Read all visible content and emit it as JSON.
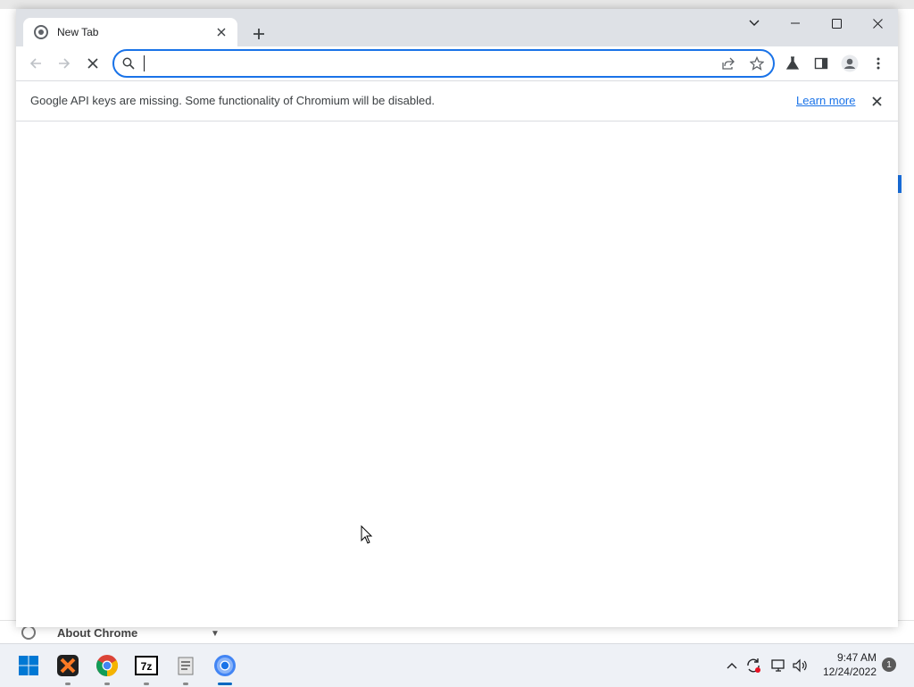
{
  "background": {
    "about_chrome_label": "About Chrome"
  },
  "browser": {
    "tab": {
      "title": "New Tab"
    },
    "omnibox": {
      "value": "",
      "placeholder": ""
    },
    "infobar": {
      "message": "Google API keys are missing. Some functionality of Chromium will be disabled.",
      "link_label": "Learn more"
    }
  },
  "taskbar": {
    "apps": [
      "start-icon",
      "xampp-icon",
      "chrome-icon",
      "7zip-icon",
      "files-icon",
      "chromium-icon"
    ],
    "sevenzip_label": "7z",
    "clock": {
      "time": "9:47 AM",
      "date": "12/24/2022"
    },
    "notification_count": "1"
  },
  "colors": {
    "accent": "#1a73e8",
    "tabstrip": "#dee1e6",
    "taskbar": "#eef1f6"
  }
}
